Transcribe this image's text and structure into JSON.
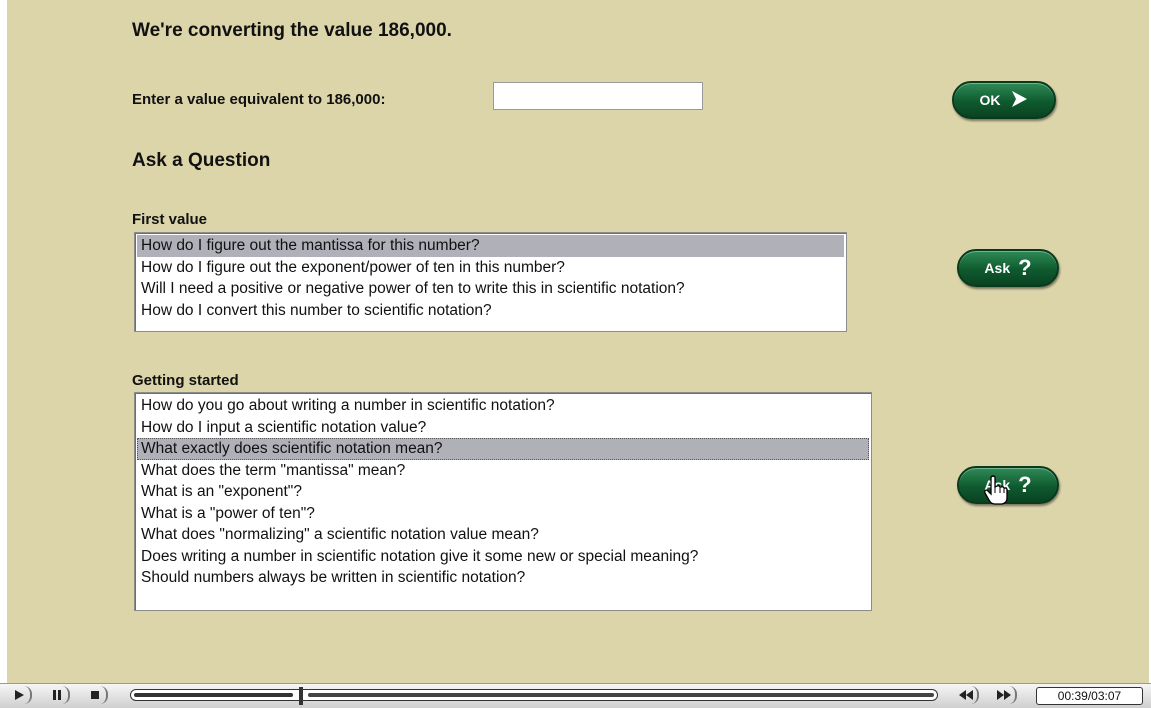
{
  "header": {
    "title": "We're converting the value 186,000."
  },
  "answer": {
    "label": "Enter a value equivalent to 186,000:",
    "value": "",
    "ok_label": "OK",
    "ok_icon": "play-arrow-icon"
  },
  "ask_heading": "Ask a Question",
  "first_value": {
    "label": "First value",
    "items": [
      "How do I figure out the mantissa for this number?",
      "How do I figure out the exponent/power of ten in this number?",
      "Will I need a positive or negative power of ten to write this in scientific notation?",
      "How do I convert this number to scientific notation?"
    ],
    "selected_index": 0,
    "ask_label": "Ask",
    "ask_icon": "question-mark-icon"
  },
  "getting_started": {
    "label": "Getting started",
    "items": [
      "How do you go about writing a number in scientific notation?",
      "How do I input a scientific notation value?",
      "What exactly does scientific notation mean?",
      "What does the term \"mantissa\" mean?",
      "What is an \"exponent\"?",
      "What is a \"power of ten\"?",
      "What does \"normalizing\" a scientific notation value mean?",
      "Does writing a number in scientific notation give it some new or special meaning?",
      "Should numbers always be written in scientific notation?"
    ],
    "selected_index": 2,
    "ask_label": "Ask",
    "ask_icon": "question-mark-icon"
  },
  "player": {
    "time": "00:39/03:07",
    "progress_fraction": 0.209,
    "buttons": [
      "play-icon",
      "pause-icon",
      "stop-icon",
      "rewind-icon",
      "fast-forward-icon"
    ]
  },
  "colors": {
    "background": "#dcd5aa",
    "button_green": "#0f5a2f",
    "selection": "#b0b0b8"
  }
}
